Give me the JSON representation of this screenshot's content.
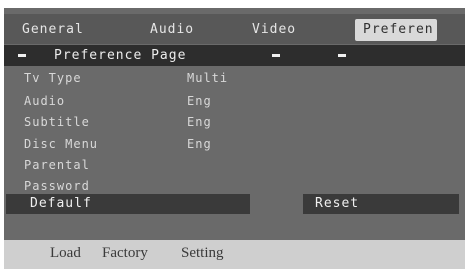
{
  "tabs": {
    "general": "General",
    "audio": "Audio",
    "video": "Video",
    "preference": "Preferen"
  },
  "page_bar": {
    "title": "Preference Page"
  },
  "settings": [
    {
      "label": "Tv Type",
      "value": "Multi"
    },
    {
      "label": "Audio",
      "value": "Eng"
    },
    {
      "label": "Subtitle",
      "value": "Eng"
    },
    {
      "label": "Disc Menu",
      "value": "Eng"
    },
    {
      "label": "Parental",
      "value": ""
    },
    {
      "label": "Password",
      "value": ""
    }
  ],
  "default_item": "Defaulf",
  "reset_item": "Reset",
  "footer": {
    "load": "Load",
    "factory": "Factory",
    "setting": "Setting"
  }
}
